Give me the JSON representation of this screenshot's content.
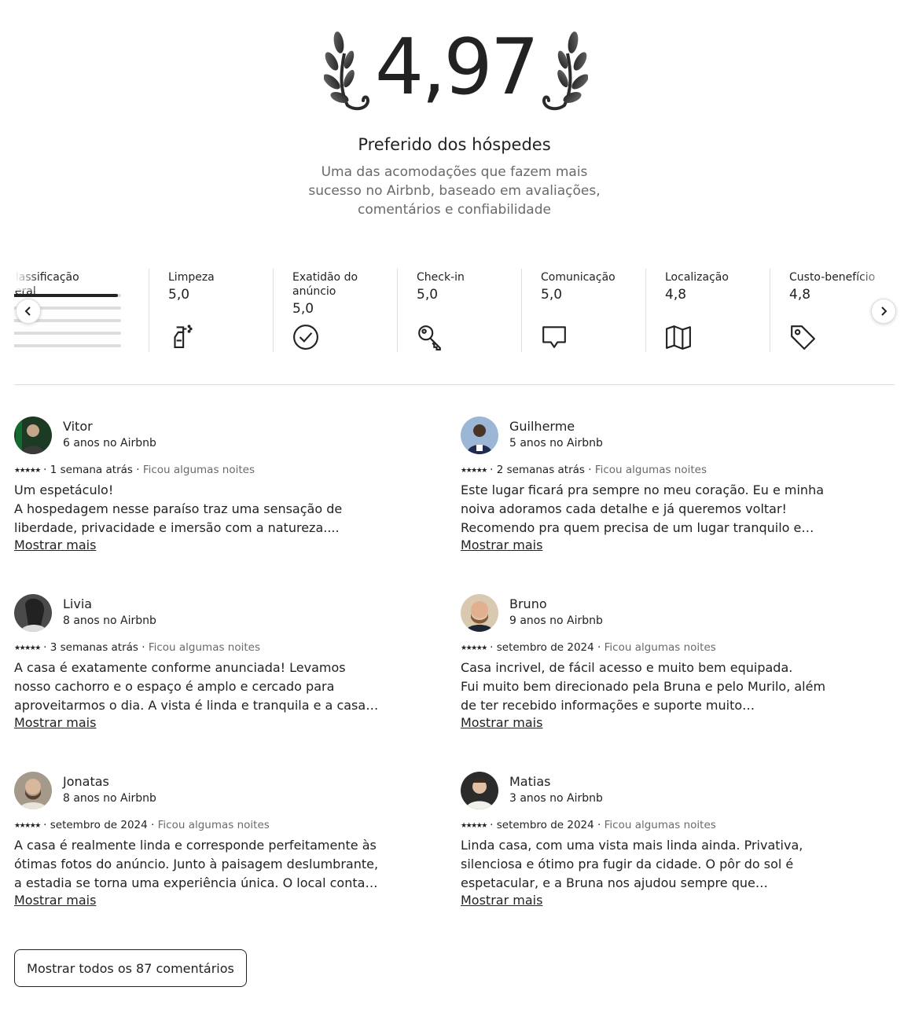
{
  "hero": {
    "rating": "4,97",
    "title": "Preferido dos hóspedes",
    "subtitle": "Uma das acomodações que fazem mais sucesso no Airbnb, baseado em avaliações, comentários e confiabilidade"
  },
  "categories": {
    "overall": {
      "label": "Classificação geral",
      "rating_distribution": [
        0.97,
        0.03,
        0,
        0,
        0
      ]
    },
    "items": [
      {
        "label": "Limpeza",
        "value": "5,0",
        "icon": "spray-bottle-icon"
      },
      {
        "label": "Exatidão do anúncio",
        "value": "5,0",
        "icon": "check-circle-icon"
      },
      {
        "label": "Check-in",
        "value": "5,0",
        "icon": "key-icon"
      },
      {
        "label": "Comunicação",
        "value": "5,0",
        "icon": "chat-bubble-icon"
      },
      {
        "label": "Localização",
        "value": "4,8",
        "icon": "map-icon"
      },
      {
        "label": "Custo-benefício",
        "value": "4,8",
        "icon": "price-tag-icon"
      }
    ],
    "prev_icon": "chevron-left-icon",
    "next_icon": "chevron-right-icon"
  },
  "reviews": [
    {
      "name": "Vitor",
      "tenure": "6 anos no Airbnb",
      "stars": "★★★★★",
      "date": "1 semana atrás",
      "stay": "Ficou algumas noites",
      "lines": [
        "Um espetáculo!",
        "A hospedagem nesse paraíso traz uma sensação de liberdade, privacidade e imersão com a natureza...."
      ],
      "avatar_color": "#2f4a2f"
    },
    {
      "name": "Guilherme",
      "tenure": "5 anos no Airbnb",
      "stars": "★★★★★",
      "date": "2 semanas atrás",
      "stay": "Ficou algumas noites",
      "lines": [
        "Este lugar ficará pra sempre no meu coração. Eu e minha noiva adoramos cada detalhe e já queremos voltar!",
        "Recomendo pra quem precisa de um lugar tranquilo e passar..."
      ],
      "avatar_color": "#6d8fb8"
    },
    {
      "name": "Livia",
      "tenure": "8 anos no Airbnb",
      "stars": "★★★★★",
      "date": "3 semanas atrás",
      "stay": "Ficou algumas noites",
      "lines": [
        "A casa é exatamente conforme anunciada! Levamos nosso cachorro e o espaço é amplo e cercado para aproveitarmos o dia. A vista é linda e tranquila e a casa bem equipada...."
      ],
      "avatar_color": "#555555"
    },
    {
      "name": "Bruno",
      "tenure": "9 anos no Airbnb",
      "stars": "★★★★★",
      "date": "setembro de 2024",
      "stay": "Ficou algumas noites",
      "lines": [
        "Casa incrivel, de fácil acesso e muito bem equipada.",
        "Fui muito bem direcionado pela Bruna e pelo Murilo, além de ter recebido informações e suporte muito rápidamnente pel..."
      ],
      "avatar_color": "#8a6a4a"
    },
    {
      "name": "Jonatas",
      "tenure": "8 anos no Airbnb",
      "stars": "★★★★★",
      "date": "setembro de 2024",
      "stay": "Ficou algumas noites",
      "lines": [
        "A casa é realmente linda e corresponde perfeitamente às ótimas fotos do anúncio. Junto à paisagem deslumbrante, a estadia se torna uma experiência única. O local conta com..."
      ],
      "avatar_color": "#7a6a58"
    },
    {
      "name": "Matias",
      "tenure": "3 anos no Airbnb",
      "stars": "★★★★★",
      "date": "setembro de 2024",
      "stay": "Ficou algumas noites",
      "lines": [
        "Linda casa, com uma vista mais linda ainda. Privativa, silenciosa e ótimo pra fugir da cidade. O pôr do sol é espetacular, e a Bruna nos ajudou sempre que necessário...."
      ],
      "avatar_color": "#3a3a3a"
    }
  ],
  "show_more_label": "Mostrar mais",
  "separator": "·",
  "show_all_label": "Mostrar todos os 87 comentários",
  "laurel_icon": "laurel-icon"
}
